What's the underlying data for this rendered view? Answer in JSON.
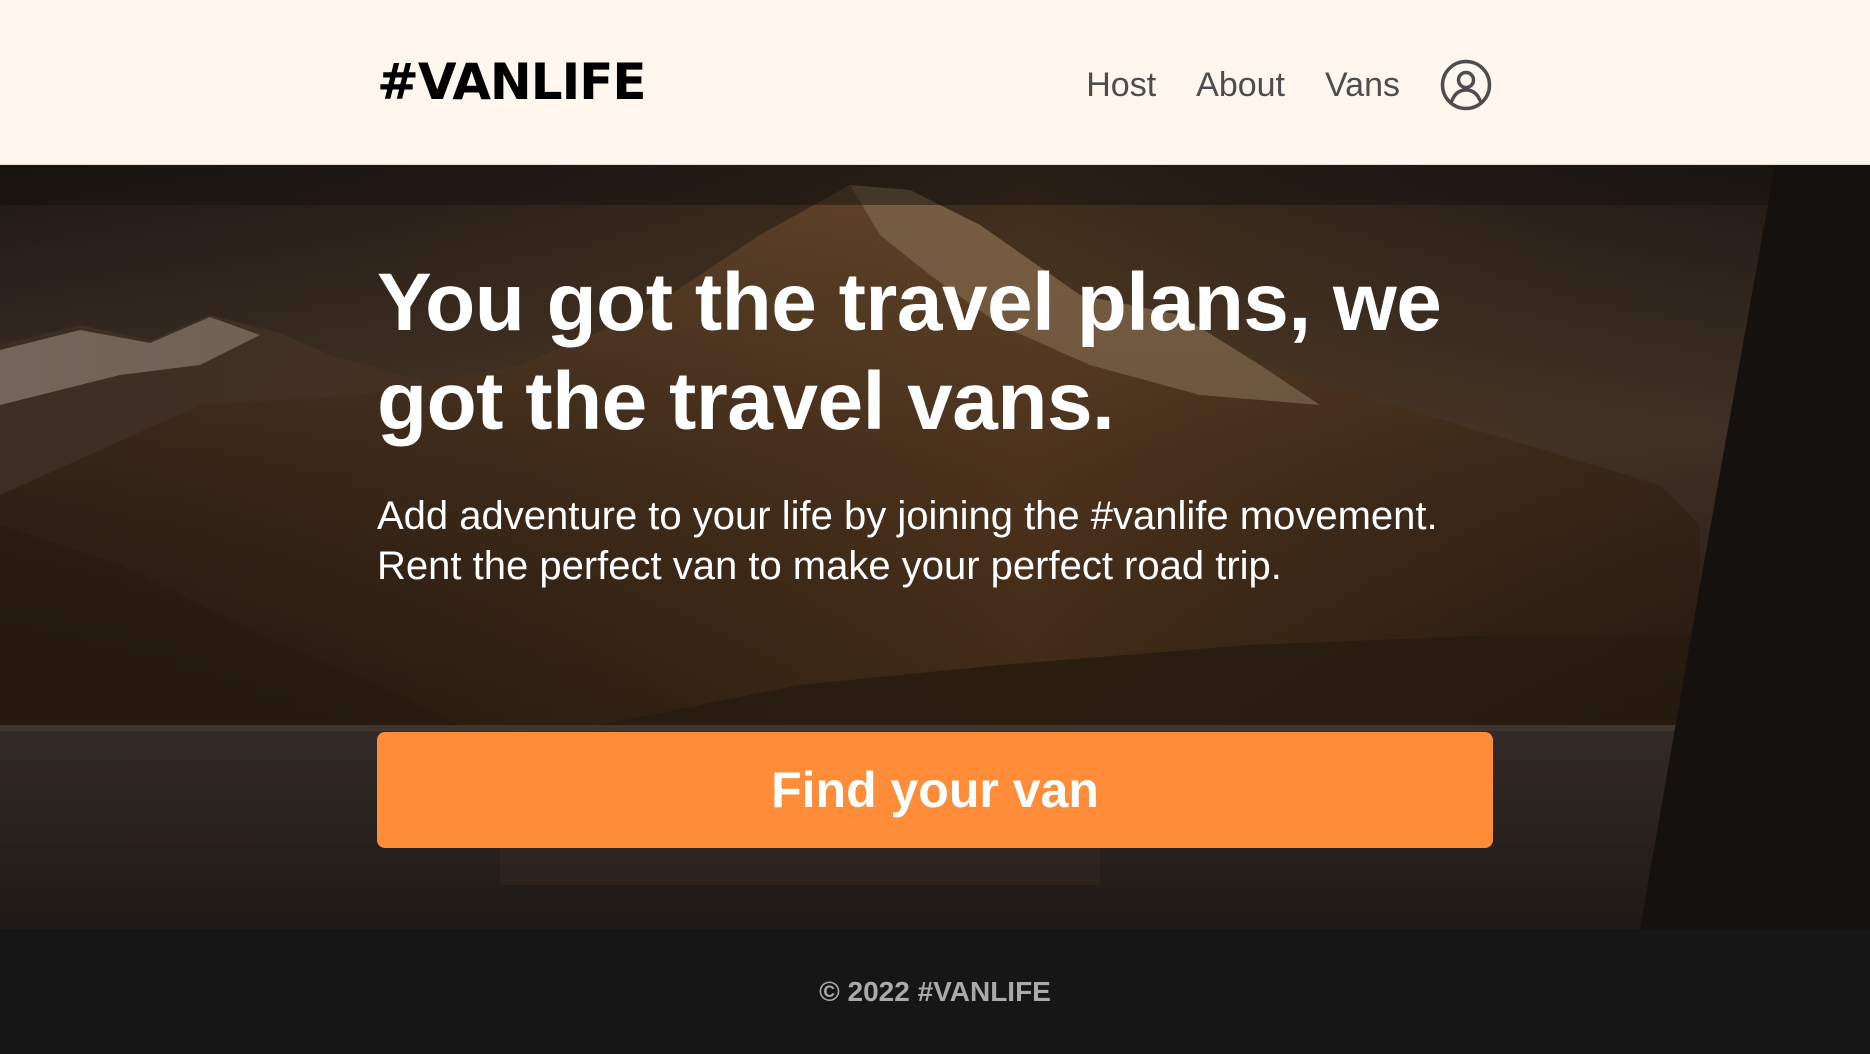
{
  "brand": {
    "logo_text": "#VANLIFE"
  },
  "nav": {
    "items": [
      {
        "label": "Host"
      },
      {
        "label": "About"
      },
      {
        "label": "Vans"
      }
    ],
    "avatar_icon": "user-circle-icon"
  },
  "hero": {
    "headline": "You got the travel plans, we got the travel vans.",
    "subtext": "Add adventure to your life by joining the #vanlife movement. Rent the perfect van to make your perfect road trip.",
    "cta_label": "Find your van",
    "background": "mountain-lake-photo"
  },
  "footer": {
    "copyright": "© 2022 #VANLIFE"
  },
  "colors": {
    "header_bg": "#FFF7ED",
    "accent": "#FF8C38",
    "footer_bg": "#161616",
    "footer_text": "#AAAAAA",
    "nav_text": "#4D4D4D"
  }
}
